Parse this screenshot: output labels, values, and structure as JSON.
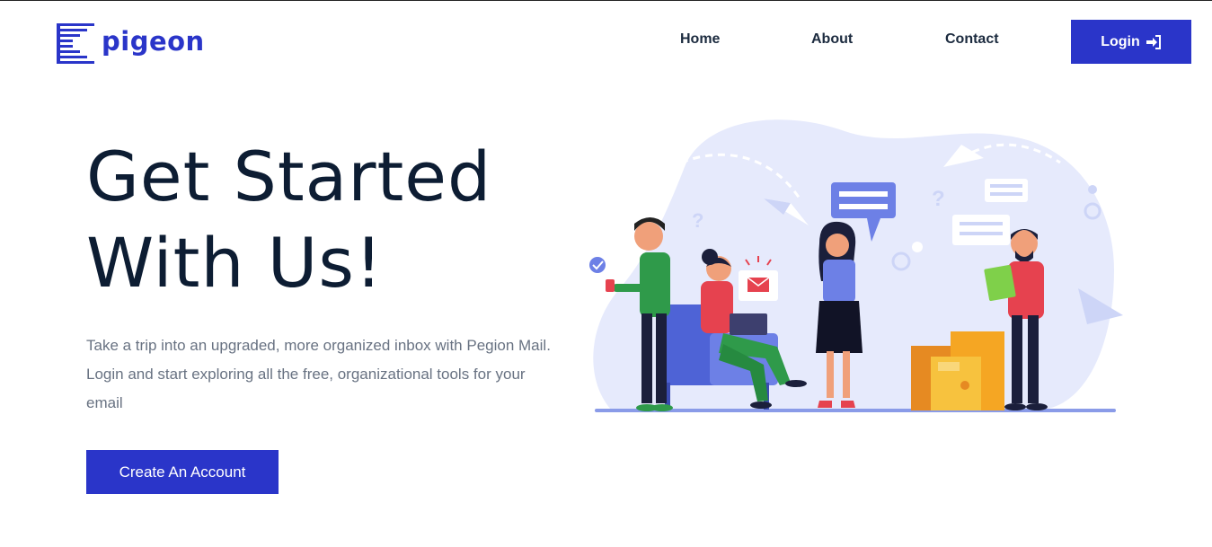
{
  "brand": {
    "name": "pigeon"
  },
  "nav": {
    "home": "Home",
    "about": "About",
    "contact": "Contact",
    "login": "Login"
  },
  "hero": {
    "title_line1": "Get Started",
    "title_line2": "With Us!",
    "description": "Take a trip into an upgraded, more organized inbox with Pegion Mail. Login and start exploring all the free, organizational tools for your email",
    "cta_label": "Create An Account"
  },
  "colors": {
    "accent": "#2a35c9",
    "heading": "#0d1d33",
    "body_text": "#687282"
  },
  "icons": {
    "login": "sign-in-icon",
    "logo": "pigeon-logo-icon"
  }
}
